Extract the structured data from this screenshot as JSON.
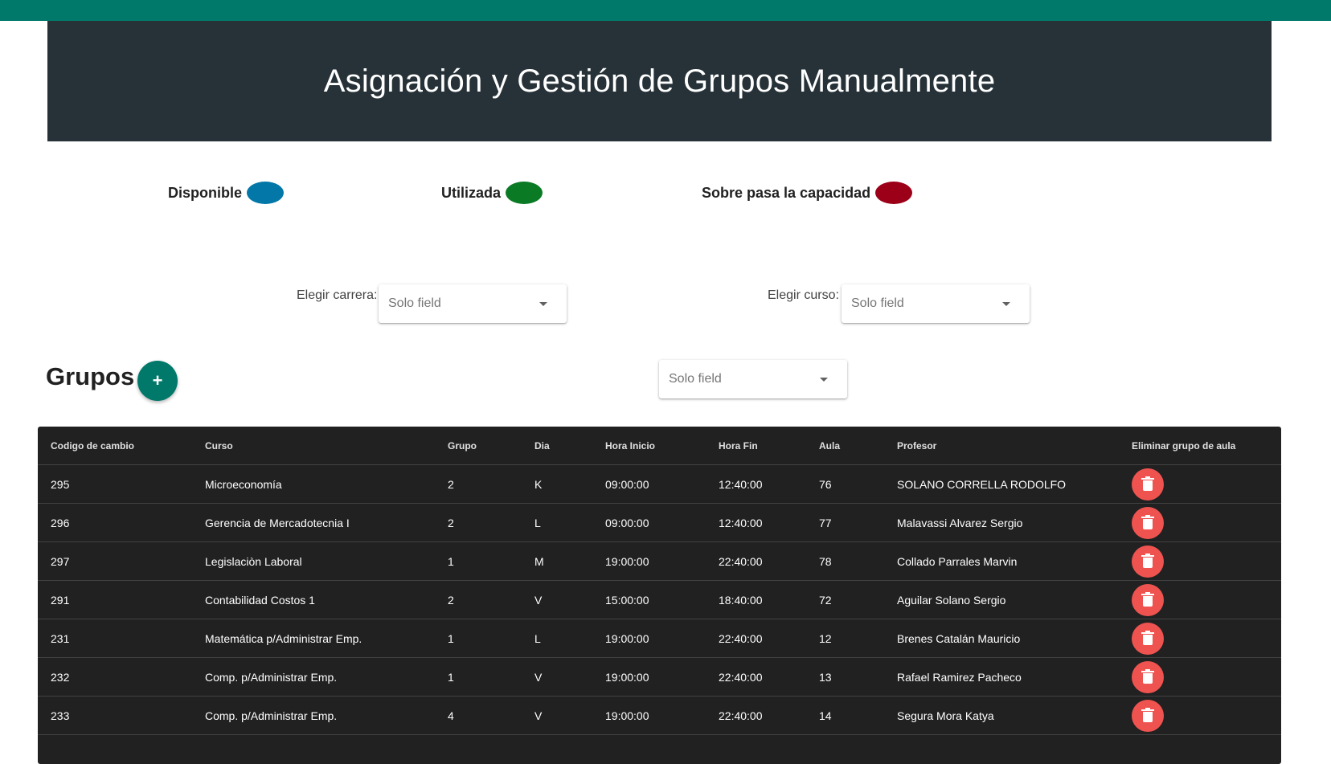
{
  "header": {
    "title": "Asignación y Gestión de Grupos Manualmente"
  },
  "legend": [
    {
      "label": "Disponible",
      "color": "#0277a8"
    },
    {
      "label": "Utilizada",
      "color": "#0b7a25"
    },
    {
      "label": "Sobre pasa la capacidad",
      "color": "#9b0018"
    }
  ],
  "filters": {
    "carrera": {
      "label": "Elegir carrera:",
      "placeholder": "Solo field"
    },
    "curso": {
      "label": "Elegir curso:",
      "placeholder": "Solo field"
    },
    "grupo": {
      "placeholder": "Solo field"
    }
  },
  "grupos": {
    "title": "Grupos",
    "add_label": "+"
  },
  "table": {
    "headers": [
      "Codigo de cambio",
      "Curso",
      "Grupo",
      "Dia",
      "Hora Inicio",
      "Hora Fin",
      "Aula",
      "Profesor",
      "Eliminar grupo de aula"
    ],
    "rows": [
      [
        "295",
        "Microeconomía",
        "2",
        "K",
        "09:00:00",
        "12:40:00",
        "76",
        "SOLANO CORRELLA RODOLFO"
      ],
      [
        "296",
        "Gerencia de Mercadotecnia I",
        "2",
        "L",
        "09:00:00",
        "12:40:00",
        "77",
        "Malavassi Alvarez Sergio"
      ],
      [
        "297",
        "Legislaciòn Laboral",
        "1",
        "M",
        "19:00:00",
        "22:40:00",
        "78",
        "Collado Parrales Marvin"
      ],
      [
        "291",
        "Contabilidad Costos 1",
        "2",
        "V",
        "15:00:00",
        "18:40:00",
        "72",
        "Aguilar Solano Sergio"
      ],
      [
        "231",
        "Matemática p/Administrar Emp.",
        "1",
        "L",
        "19:00:00",
        "22:40:00",
        "12",
        "Brenes Catalán Mauricio"
      ],
      [
        "232",
        "Comp. p/Administrar Emp.",
        "1",
        "V",
        "19:00:00",
        "22:40:00",
        "13",
        "Rafael Ramirez Pacheco"
      ],
      [
        "233",
        "Comp. p/Administrar Emp.",
        "4",
        "V",
        "19:00:00",
        "22:40:00",
        "14",
        "Segura Mora Katya"
      ]
    ]
  }
}
